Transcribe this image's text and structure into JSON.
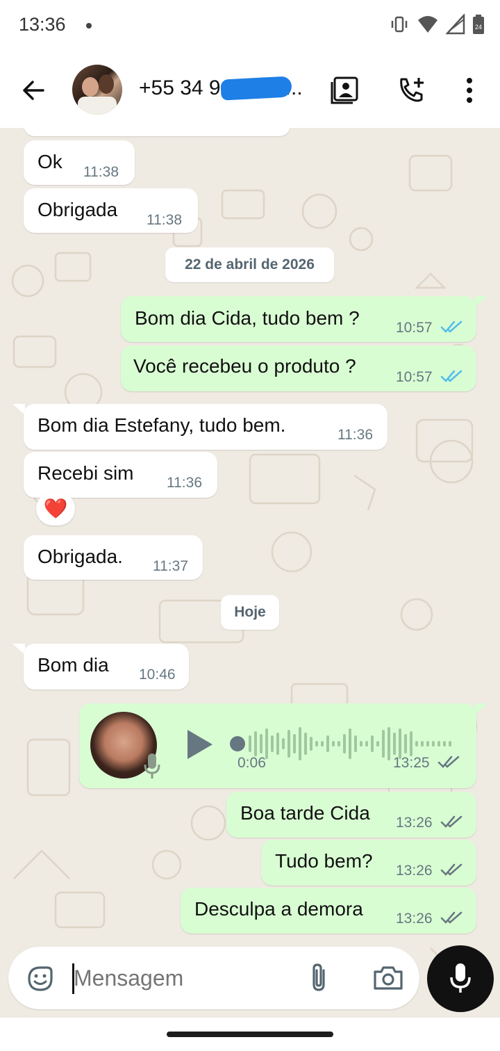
{
  "status_bar": {
    "time": "13:36",
    "battery": "24"
  },
  "header": {
    "contact_name": "+55 34 9",
    "contact_suffix": "..."
  },
  "messages": [
    {
      "dir": "in",
      "text": "Ok",
      "time": "11:38"
    },
    {
      "dir": "in",
      "text": "Obrigada",
      "time": "11:38"
    },
    {
      "dir": "out",
      "text": "Bom dia Cida, tudo bem ?",
      "time": "10:57",
      "status": "read"
    },
    {
      "dir": "out",
      "text": "Você recebeu o produto ?",
      "time": "10:57",
      "status": "read"
    },
    {
      "dir": "in",
      "text": "Bom dia Estefany, tudo bem.",
      "time": "11:36"
    },
    {
      "dir": "in",
      "text": "Recebi sim",
      "time": "11:36",
      "reaction": "❤️"
    },
    {
      "dir": "in",
      "text": "Obrigada.",
      "time": "11:37"
    },
    {
      "dir": "in",
      "text": "Bom dia",
      "time": "10:46"
    },
    {
      "dir": "out",
      "text": "Boa tarde Cida",
      "time": "13:26",
      "status": "delivered"
    },
    {
      "dir": "out",
      "text": "Tudo bem?",
      "time": "13:26",
      "status": "delivered"
    },
    {
      "dir": "out",
      "text": "Desculpa a demora",
      "time": "13:26",
      "status": "delivered"
    }
  ],
  "date_chips": [
    "22 de abril de 2026",
    "Hoje"
  ],
  "voice_note": {
    "duration": "0:06",
    "time": "13:25",
    "status": "delivered"
  },
  "composer": {
    "placeholder": "Mensagem"
  },
  "colors": {
    "incoming": "#ffffff",
    "outgoing": "#d9fdd3",
    "chat_bg": "#efeae2",
    "read_ticks": "#53bdeb",
    "mic_button": "#111111"
  }
}
